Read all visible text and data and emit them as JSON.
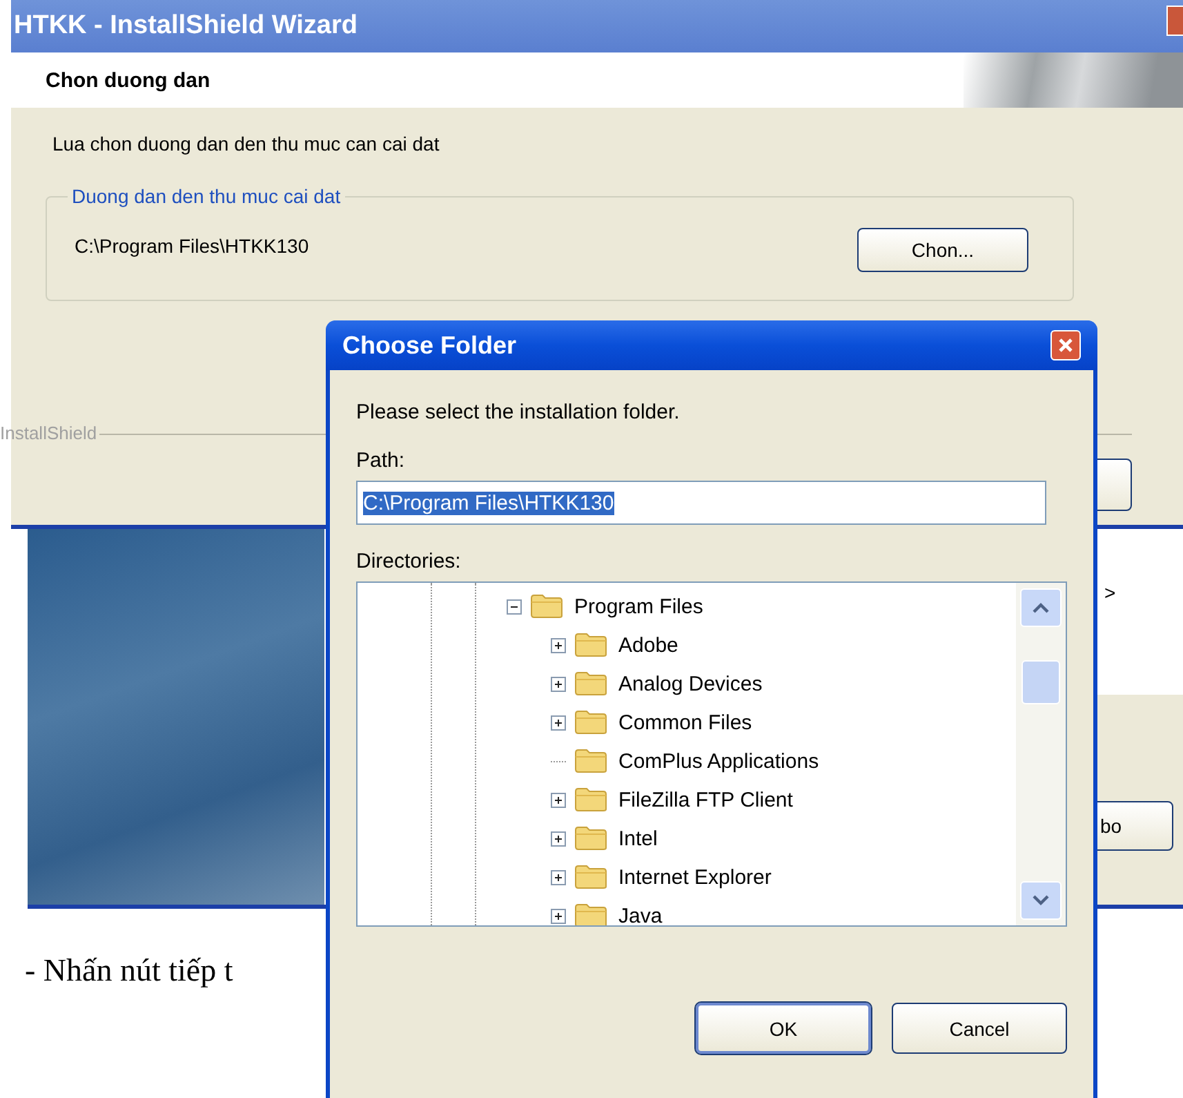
{
  "wizard": {
    "title": "HTKK - InstallShield Wizard",
    "header": "Chon duong dan",
    "description": "Lua chon duong dan den thu muc can cai dat",
    "group_label": "Duong dan den thu muc cai dat",
    "path": "C:\\Program Files\\HTKK130",
    "browse_button": "Chon...",
    "brand": "InstallShield"
  },
  "background_window": {
    "text_fragment": ">",
    "button": "bo"
  },
  "document_text": "- Nhấn nút tiếp t",
  "dialog": {
    "title": "Choose Folder",
    "prompt": "Please select the installation folder.",
    "path_label": "Path:",
    "path_value": "C:\\Program Files\\HTKK130",
    "path_selected": true,
    "directories_label": "Directories:",
    "tree": [
      {
        "label": "Program Files",
        "expandable": true,
        "expanded": true,
        "children": [
          {
            "label": "Adobe",
            "expandable": true,
            "expanded": false
          },
          {
            "label": "Analog Devices",
            "expandable": true,
            "expanded": false
          },
          {
            "label": "Common Files",
            "expandable": true,
            "expanded": false
          },
          {
            "label": "ComPlus Applications",
            "expandable": false
          },
          {
            "label": "FileZilla FTP Client",
            "expandable": true,
            "expanded": false
          },
          {
            "label": "Intel",
            "expandable": true,
            "expanded": false
          },
          {
            "label": "Internet Explorer",
            "expandable": true,
            "expanded": false
          },
          {
            "label": "Java",
            "expandable": true,
            "expanded": false
          }
        ]
      }
    ],
    "buttons": [
      "OK",
      "Cancel"
    ]
  }
}
